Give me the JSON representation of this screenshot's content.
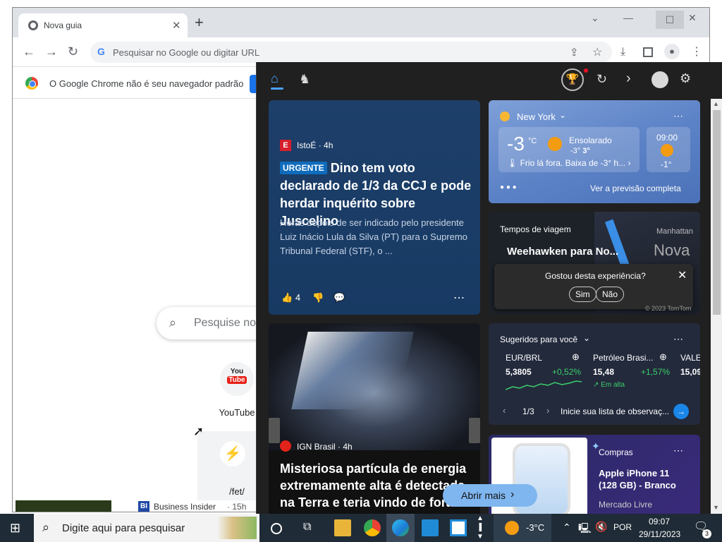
{
  "chrome": {
    "tab_title": "Nova guia",
    "omnibox_placeholder": "Pesquisar no Google ou digitar URL",
    "infobar_text": "O Google Chrome não é seu navegador padrão",
    "ntp_search_placeholder": "Pesquise no",
    "shortcuts": [
      {
        "label": "YouTube",
        "icon": "youtube-icon"
      },
      {
        "label": "/fet/",
        "icon": "bolt-icon"
      }
    ],
    "bottom_news": {
      "source": "Business Insider",
      "age": "15h"
    }
  },
  "flyout": {
    "top_icons": [
      "home-icon",
      "chess-knight-icon",
      "trophy-icon",
      "refresh-icon",
      "chevron-right-icon",
      "profile-icon",
      "settings-icon"
    ],
    "card1": {
      "source": "IstoÉ",
      "age": "4h",
      "badge": "URGENTE",
      "headline": "Dino tem voto declarado de 1/3 da CCJ e pode herdar inquérito sobre Juscelino",
      "summary": "Horas depois de ser indicado pelo presidente Luiz Inácio Lula da Silva (PT) para o Supremo Tribunal Federal (STF), o ...",
      "likes": "4"
    },
    "card2": {
      "source": "IGN Brasil",
      "age": "4h",
      "headline": "Misteriosa partícula de energia extremamente alta é detectada na Terra e teria vindo de fora..."
    },
    "weather": {
      "city": "New York",
      "temp": "-3",
      "unit": "°C",
      "condition": "Ensolarado",
      "range_low": "-3°",
      "range_high": "3°",
      "note": "Frio lá fora. Baixa de -3° h...",
      "hour": "09:00",
      "hour_temp": "-1°",
      "forecast_link": "Ver a previsão completa"
    },
    "traffic": {
      "title": "Tempos de viagem",
      "route": "Weehawken para No...",
      "map_label_1": "Manhattan",
      "map_label_2": "Nova",
      "feedback_question": "Gostou desta experiência?",
      "yes": "Sim",
      "no": "Não",
      "map_credit": "© 2023 TomTom"
    },
    "markets": {
      "title": "Sugeridos para você",
      "items": [
        {
          "name": "EUR/BRL",
          "value": "5,3805",
          "change": "+0,52%"
        },
        {
          "name": "Petróleo Brasi...",
          "value": "15,48",
          "change": "+1,57%",
          "note": "Em alta"
        },
        {
          "name": "VALE",
          "value": "15,09",
          "change": ""
        }
      ],
      "pager": "1/3",
      "cta": "Inicie sua lista de observaç..."
    },
    "shop": {
      "category": "Compras",
      "product": "Apple iPhone 11 (128 GB) - Branco",
      "seller": "Mercado Livre"
    },
    "open_more": "Abrir mais"
  },
  "taskbar": {
    "search_placeholder": "Digite aqui para pesquisar",
    "weather_temp": "-3°C",
    "language": "POR",
    "time": "09:07",
    "date": "29/11/2023",
    "notif_count": "3"
  }
}
